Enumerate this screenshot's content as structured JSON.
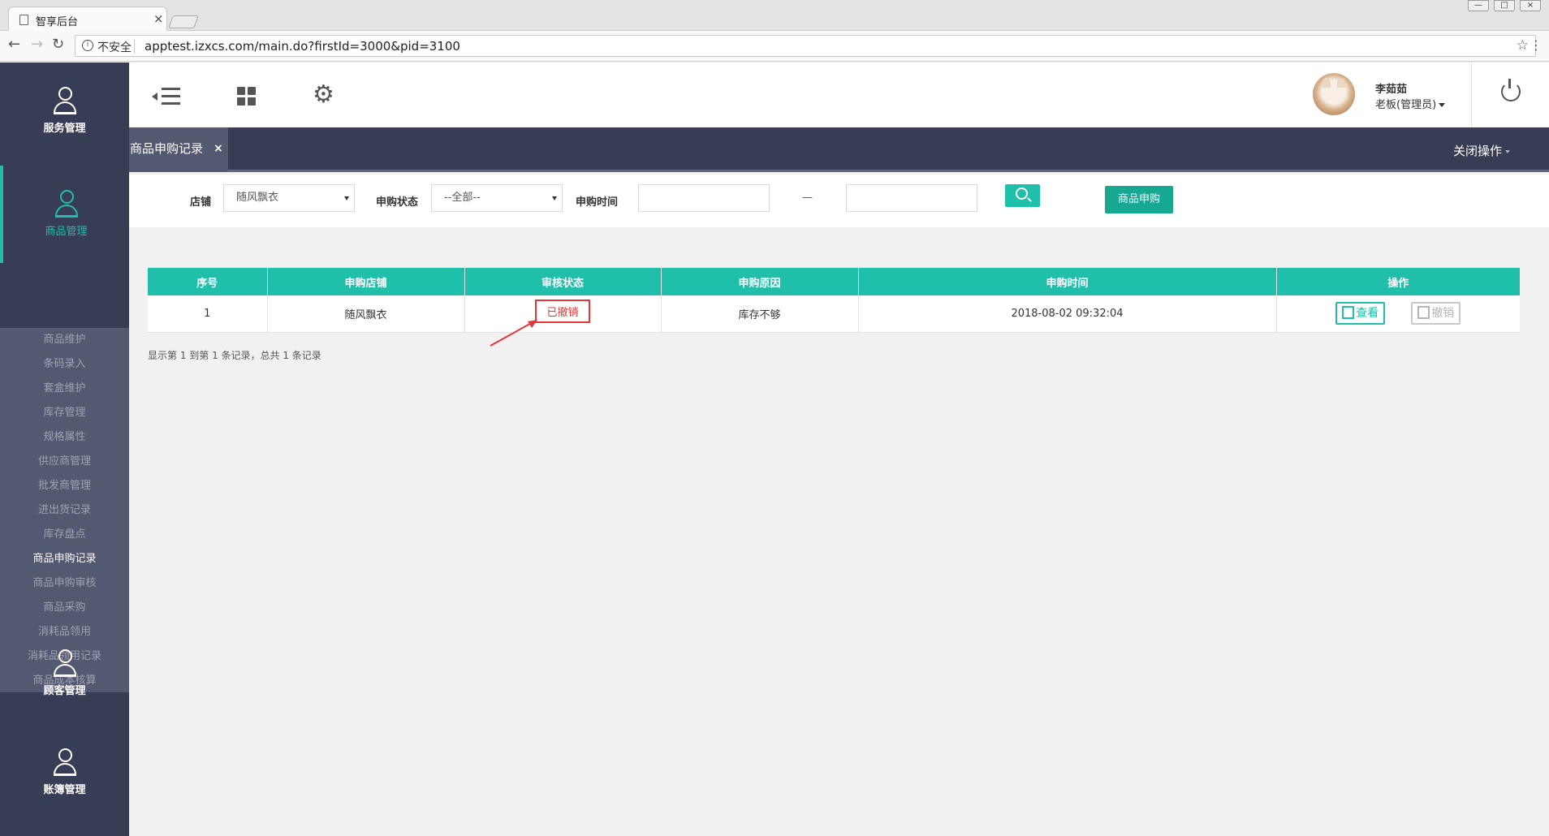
{
  "browser": {
    "tab_title": "智享后台",
    "tab_close": "×",
    "security_label": "不安全",
    "url": "apptest.izxcs.com/main.do?firstId=3000&pid=3100",
    "window_buttons": [
      "—",
      "□",
      "×"
    ]
  },
  "sidebar": {
    "modules": [
      {
        "label": "服务管理",
        "icon": "person-icon"
      },
      {
        "label": "商品管理",
        "icon": "person-icon",
        "active": true
      },
      {
        "label": "顾客管理",
        "icon": "person-icon"
      },
      {
        "label": "账簿管理",
        "icon": "person-icon"
      }
    ],
    "submenu": [
      "商品维护",
      "条码录入",
      "套盒维护",
      "库存管理",
      "规格属性",
      "供应商管理",
      "批发商管理",
      "进出货记录",
      "库存盘点",
      "商品申购记录",
      "商品申购审核",
      "商品采购",
      "消耗品领用",
      "消耗品领用记录",
      "商品成本核算"
    ],
    "current_submenu": "商品申购记录"
  },
  "header": {
    "user_name": "李茹茹",
    "user_role": "老板(管理员)"
  },
  "tabs": {
    "open_tab": "商品申购记录",
    "close_x": "×",
    "close_ops": "关闭操作"
  },
  "filters": {
    "store_label": "店铺",
    "store_value": "随风飘衣",
    "status_label": "申购状态",
    "status_value": "--全部--",
    "time_label": "申购时间",
    "time_separator": "—",
    "apply_button": "商品申购"
  },
  "table": {
    "columns": [
      "序号",
      "申购店铺",
      "审核状态",
      "申购原因",
      "申购时间",
      "操作"
    ],
    "rows": [
      {
        "index": "1",
        "store": "随风飘衣",
        "status": "已撤销",
        "reason": "库存不够",
        "time": "2018-08-02 09:32:04",
        "view": "查看",
        "cancel": "撤销"
      }
    ],
    "footer": "显示第 1 到第 1 条记录，总共 1 条记录"
  },
  "colors": {
    "accent": "#1fbfaa",
    "sidebar": "#373d55",
    "submenu": "#535970",
    "annotation": "#e53535"
  }
}
